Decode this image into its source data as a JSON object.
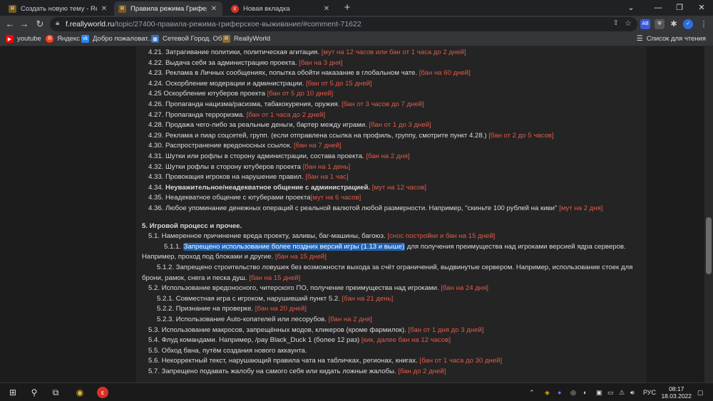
{
  "tabs": [
    {
      "title": "Создать новую тему - ReallyW",
      "favicon": "reallyworld-icon"
    },
    {
      "title": "Правила режима Гриферское в",
      "favicon": "reallyworld-icon"
    },
    {
      "title": "Новая вкладка",
      "favicon": "new-tab-icon"
    }
  ],
  "address": {
    "host": "f.reallyworld.ru",
    "path": "/topic/27400-правила-режима-гриферское-выживание/#comment-71622"
  },
  "bookmarks": [
    {
      "label": "youtube",
      "icon": "youtube-icon",
      "color": "#ff0000"
    },
    {
      "label": "Яндекс",
      "icon": "yandex-icon",
      "color": "#fc3f1d"
    },
    {
      "label": "Добро пожаловат...",
      "icon": "vk-icon",
      "color": "#2787f5"
    },
    {
      "label": "Сетевой Город. Об...",
      "icon": "school-icon",
      "color": "#3a6fb5"
    },
    {
      "label": "ReallyWorld",
      "icon": "reallyworld-icon",
      "color": "#8a6d2b"
    }
  ],
  "reading_list": "Список для чтения",
  "rules": [
    {
      "text": "4.21. Затрагивание политики, политическая агитация. ",
      "pen": "[мут на 12 часов или  бан от 1 часа до 2 дней]"
    },
    {
      "text": "4.22. Выдача себя за администрацию проекта. ",
      "pen": "[бан на 3 дня]"
    },
    {
      "text": "4.23. Реклама в Личных сообщениях, попытка обойти наказание в глобальном чате. ",
      "pen": "[бан на 60 дней]"
    },
    {
      "text": "4.24. Оскорбление модерации и администрации. ",
      "pen": "[бан от 5 до 15 дней]"
    },
    {
      "text": "4.25 Оскорбление ютуберов проекта ",
      "pen": "[бан от 5 до 10 дней]"
    },
    {
      "text": "4.26. Пропаганда нацизма/расизма, табакокурения, оружия. ",
      "pen": "[бан от 3 часов до 7 дней]"
    },
    {
      "text": "4.27. Пропаганда терроризма. ",
      "pen": "[бан от 1 часа до 2 дней]"
    },
    {
      "text": "4.28. Продажа чего-либо за реальные деньги, бартер между играми. ",
      "pen": "[бан от 1 до 3 дней]"
    },
    {
      "text": "4.29. Реклама и пиар соцсетей, групп. (если отправлена ссылка на профиль, группу, смотрите пункт 4.28.) ",
      "pen": "[бан от 2 до 5 часов]"
    },
    {
      "text": "4.30. Распространение вредоносных ссылок. ",
      "pen": "[бан на 7 дней]"
    },
    {
      "text": "4.31. Шутки или рофлы в сторону администрации, состава проекта. ",
      "pen": "[бан на 2 дня]"
    },
    {
      "text": "4.32. Шутки рофлы в сторону ютуберов проекта ",
      "pen": "[бан на 1 день]"
    },
    {
      "text": "4.33. Провокация игроков на нарушение правил. ",
      "pen": "[бан на 1 час]"
    },
    {
      "text": "4.34. ",
      "bold": "Неуважительное/неадекватное общение с администрацией.",
      "pen": "  [мут на 12 часов]"
    },
    {
      "text": "4.35. Неадекватное общение с ютуберами проекта",
      "pen": "[мут на 6 часов]"
    },
    {
      "text": "4.36. Любое упоминание денежных операций с реальной валютой любой размерности. Например, \"скиньте 100 рублей на киви\" ",
      "pen": "[мут на 2 дня]"
    }
  ],
  "section5": {
    "heading": "5. Игровой процесс и прочее.",
    "items": [
      {
        "text": "5.1. Намеренное причинение вреда проекту, заливы, баг-машины, багоюз. ",
        "pen": "[снос постройки и бан на 15 дней]"
      },
      {
        "prefix": "5.1.1. ",
        "highlight": "Запрещено использование более поздних версий игры (1.13 и выше)",
        "text": " для получения преимущества над игроками версией ядра серверов."
      },
      {
        "text": "Например, проход под блоками и другие. ",
        "pen": " [бан на 15 дней]"
      },
      {
        "text": "5.1.2. Запрещено строительство ловушек без возможности выхода за счёт ограничений, выдвинутые сервером. Например, использование стоек для"
      },
      {
        "text": "брони, рамок, снега и песка душ. ",
        "pen": "[бан на 15 дней]"
      },
      {
        "text": "5.2. Использование вредоносного, читерского ПО, получение преимущества над игроками. ",
        "pen": "[бан на 24 дня]"
      },
      {
        "text": "5.2.1. Совместная игра с игроком, нарушивший пункт 5.2. ",
        "pen": "[бан на 21 день]"
      },
      {
        "text": "5.2.2. Признание на проверке.  ",
        "pen": "[бан на 20 дней]"
      },
      {
        "text": "5.2.3. Использование Auto-копателей или лесорубов. ",
        "pen": "[бан на 2 дня]"
      },
      {
        "text": "5.3. Использование макросов, запрещённых модов, кликеров (кроме фармилок). ",
        "pen": "[бан от 1 дня до 3 дней]"
      },
      {
        "text": "5.4. Флуд командами. Например, /pay Black_Duck 1 (более 12 раз) ",
        "pen": "[кик, далее бан на 12 часов]"
      },
      {
        "text": "5.5. Обход бана, путём создания нового аккаунта."
      },
      {
        "text": "5.6. Некорректный текст, нарушающий правила чата на табличках, регионах, книгах. ",
        "pen": "[бан от 1 часа до 30 дней]"
      },
      {
        "text": "5.7. Запрещено подавать жалобу на самого себя или кидать ложные жалобы. ",
        "pen": "[бан до 2 дней]"
      }
    ]
  },
  "taskbar": {
    "lang": "РУС",
    "time": "08:17",
    "date": "18.03.2022"
  }
}
